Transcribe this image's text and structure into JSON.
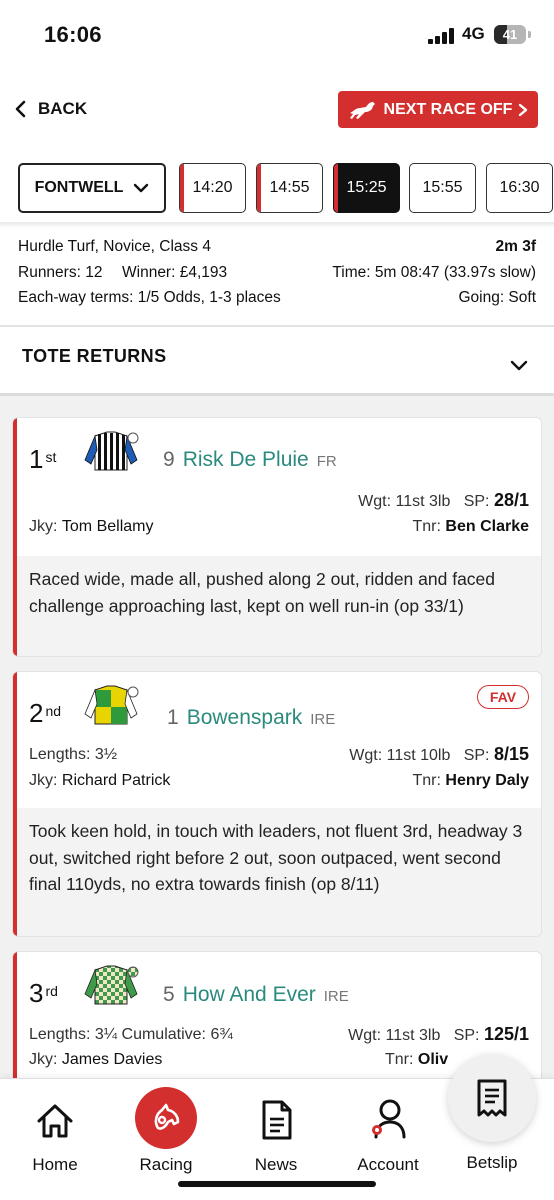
{
  "status": {
    "time": "16:06",
    "network": "4G",
    "battery": "41",
    "battery_level": 0.41
  },
  "nav": {
    "back_label": "BACK",
    "next_race_label": "NEXT RACE OFF"
  },
  "course": {
    "name": "FONTWELL"
  },
  "times": [
    {
      "label": "14:20",
      "red": true,
      "active": false
    },
    {
      "label": "14:55",
      "red": true,
      "active": false
    },
    {
      "label": "15:25",
      "red": true,
      "active": true
    },
    {
      "label": "15:55",
      "red": false,
      "active": false
    },
    {
      "label": "16:30",
      "red": false,
      "active": false
    }
  ],
  "race": {
    "type": "Hurdle Turf, Novice, Class 4",
    "distance": "2m 3f",
    "runners": "Runners: 12",
    "winner": "Winner: £4,193",
    "time": "Time: 5m 08:47 (33.97s slow)",
    "each_way": "Each-way terms: 1/5 Odds, 1-3 places",
    "going": "Going: Soft"
  },
  "tote": {
    "label": "TOTE RETURNS"
  },
  "runners": [
    {
      "pos": "1",
      "pos_suffix": "st",
      "number": "9",
      "name": "Risk De Pluie",
      "country": "FR",
      "wgt_label": "Wgt:",
      "wgt": "11st 3lb",
      "sp_label": "SP:",
      "sp": "28/1",
      "jky_label": "Jky:",
      "jockey": "Tom Bellamy",
      "tnr_label": "Tnr:",
      "trainer": "Ben Clarke",
      "comment": "Raced wide, made all, pushed along 2 out, ridden and faced challenge approaching last, kept on well run-in (op 33/1)"
    },
    {
      "pos": "2",
      "pos_suffix": "nd",
      "number": "1",
      "name": "Bowenspark",
      "country": "IRE",
      "fav": "FAV",
      "lengths": "Lengths: 3½",
      "wgt_label": "Wgt:",
      "wgt": "11st 10lb",
      "sp_label": "SP:",
      "sp": "8/15",
      "jky_label": "Jky:",
      "jockey": "Richard Patrick",
      "tnr_label": "Tnr:",
      "trainer": "Henry Daly",
      "comment": "Took keen hold, in touch with leaders, not fluent 3rd, headway 3 out, switched right before 2 out, soon outpaced, went second final 110yds, no extra towards finish (op 8/11)"
    },
    {
      "pos": "3",
      "pos_suffix": "rd",
      "number": "5",
      "name": "How And Ever",
      "country": "IRE",
      "lengths": "Lengths: 3¼ Cumulative: 6¾",
      "wgt_label": "Wgt:",
      "wgt": "11st 3lb",
      "sp_label": "SP:",
      "sp": "125/1",
      "jky_label": "Jky:",
      "jockey": "James Davies",
      "tnr_label": "Tnr:",
      "trainer": "Oliv"
    }
  ],
  "bottom_nav": {
    "home": "Home",
    "racing": "Racing",
    "news": "News",
    "account": "Account",
    "betslip": "Betslip"
  },
  "colors": {
    "accent": "#d32f2f",
    "runner_name": "#2b8a7e"
  },
  "icons": [
    "chevron-left-icon",
    "horse-icon",
    "chevron-down-icon",
    "home-icon",
    "racing-horse-icon",
    "news-icon",
    "account-icon",
    "betslip-icon"
  ]
}
